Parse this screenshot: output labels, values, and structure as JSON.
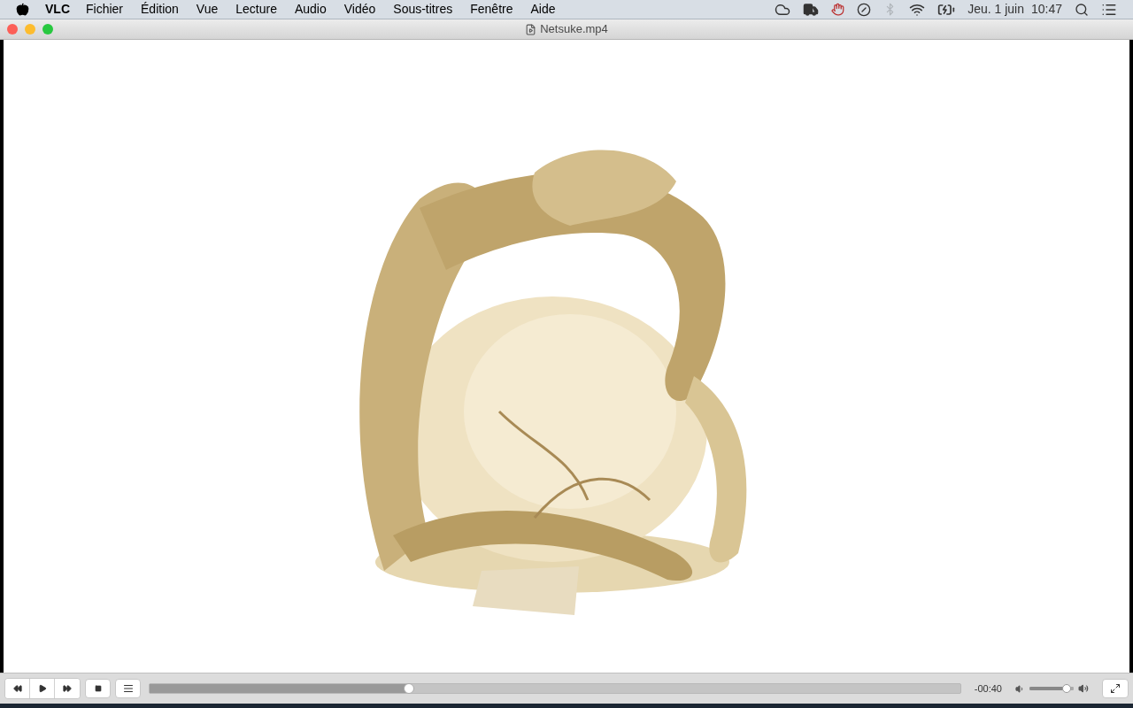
{
  "menu_bar": {
    "app": "VLC",
    "menus": [
      "Fichier",
      "Édition",
      "Vue",
      "Lecture",
      "Audio",
      "Vidéo",
      "Sous-titres",
      "Fenêtre",
      "Aide"
    ],
    "date": "Jeu. 1 juin",
    "time": "10:47"
  },
  "window": {
    "title": "Netsuke.mp4"
  },
  "player": {
    "progress": {
      "level": 0.32
    },
    "remaining": "-00:40",
    "volume": {
      "level": 0.92
    }
  }
}
